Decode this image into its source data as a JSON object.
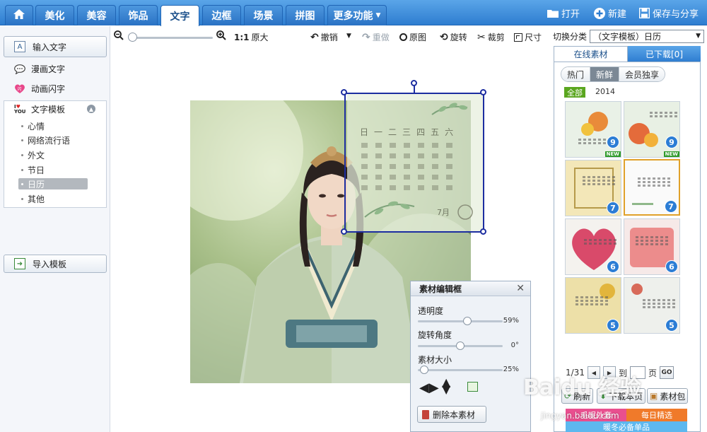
{
  "nav": {
    "home_icon": "home-icon",
    "tabs": [
      {
        "label": "美化"
      },
      {
        "label": "美容"
      },
      {
        "label": "饰品"
      },
      {
        "label": "文字"
      },
      {
        "label": "边框"
      },
      {
        "label": "场景"
      },
      {
        "label": "拼图"
      },
      {
        "label": "更多功能"
      }
    ],
    "active_tab": "文字",
    "actions": {
      "open": "打开",
      "new": "新建",
      "save": "保存与分享"
    }
  },
  "left": {
    "input_text": "输入文字",
    "comic_text": "漫画文字",
    "flash_text": "动画闪字",
    "template_title": "文字模板",
    "template_items": [
      "心情",
      "网络流行语",
      "外文",
      "节日",
      "日历",
      "其他"
    ],
    "selected_item": "日历",
    "import_template": "导入模板"
  },
  "toolbar": {
    "ratio": "1:1",
    "original_size": "原大",
    "undo": "撤销",
    "redo": "重做",
    "original": "原图",
    "rotate": "旋转",
    "crop": "裁剪",
    "size": "尺寸"
  },
  "calendar": {
    "weekdays": [
      "日",
      "一",
      "二",
      "三",
      "四",
      "五",
      "六"
    ],
    "signature": "7月"
  },
  "editor": {
    "title": "素材编辑框",
    "opacity_label": "透明度",
    "opacity_value": "59%",
    "opacity": 0.59,
    "rotation_label": "旋转角度",
    "rotation_value": "0°",
    "rotation": 0,
    "size_label": "素材大小",
    "size_value": "25%",
    "size": 0.25,
    "delete_label": "删除本素材"
  },
  "right": {
    "category_label": "切换分类",
    "category_value": "（文字模板）日历",
    "tab_online": "在线素材",
    "tab_downloaded": "已下载[0]",
    "filters": [
      "热门",
      "新鲜",
      "会员独享"
    ],
    "active_filter": "新鲜",
    "all_label": "全部",
    "year": "2014",
    "thumbnails": [
      {
        "count": "9",
        "new": "NEW"
      },
      {
        "count": "9",
        "new": "NEW"
      },
      {
        "count": "7",
        "new": ""
      },
      {
        "count": "7",
        "new": ""
      },
      {
        "count": "6",
        "new": ""
      },
      {
        "count": "6",
        "new": ""
      },
      {
        "count": "5",
        "new": ""
      },
      {
        "count": "5",
        "new": ""
      }
    ],
    "page": "1/31",
    "go_to": "到",
    "page_unit": "页",
    "go": "GO",
    "refresh": "刷新",
    "download_page": "下载本页",
    "material_pack": "素材包",
    "banner_line1": "毛呢外套",
    "banner_line2": "每日精选",
    "banner_line3": "暖冬必备单品"
  },
  "watermark": {
    "text": "Baidu 经验",
    "url": "jingyan.baidu.com"
  },
  "colors": {
    "nav_blue": "#2e7dd0",
    "selection_blue": "#1c2da0",
    "accent_orange": "#e0a12a",
    "new_green": "#2f9b2b"
  }
}
